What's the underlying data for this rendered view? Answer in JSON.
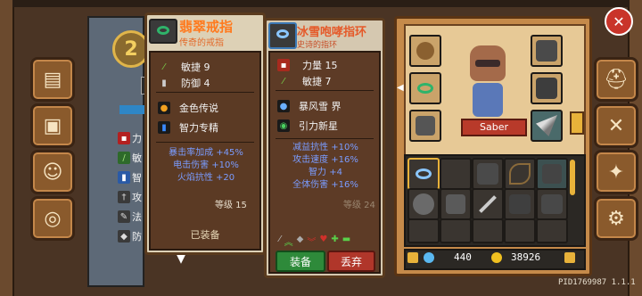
{
  "left_card": {
    "name": "翡翠戒指",
    "rarity": "传奇的戒指",
    "stats": [
      {
        "icon": "agility-icon",
        "label": "敏捷 9"
      },
      {
        "icon": "defense-icon",
        "label": "防御 4"
      }
    ],
    "perks": [
      {
        "icon": "gold-legend-icon",
        "label": "金色传说"
      },
      {
        "icon": "intellect-icon",
        "label": "智力专精"
      }
    ],
    "bonuses": [
      "暴击率加成 +45%",
      "电击伤害 +10%",
      "火焰抗性 +20"
    ],
    "level": "等级 15",
    "status": "已装备"
  },
  "right_card": {
    "name": "冰雪咆哮指环",
    "rarity": "史诗的指环",
    "stats": [
      {
        "icon": "strength-icon",
        "label": "力量 15"
      },
      {
        "icon": "agility-icon",
        "label": "敏捷 7"
      }
    ],
    "perks": [
      {
        "icon": "blizzard-icon",
        "label": "暴风雪 界"
      },
      {
        "icon": "gravity-icon",
        "label": "引力新星"
      }
    ],
    "bonuses": [
      "减益抗性 +10%",
      "攻击速度 +16%",
      "智力 +4",
      "全体伤害 +16%"
    ],
    "level": "等级 24",
    "equip_label": "装备",
    "discard_label": "丢弃"
  },
  "left_panel": {
    "level_badge": "2",
    "rows": [
      {
        "icon": "shirt-icon",
        "label": "力"
      },
      {
        "icon": "feather-icon",
        "label": "敏"
      },
      {
        "icon": "book-icon",
        "label": "智"
      },
      {
        "icon": "sword-icon",
        "label": "攻"
      },
      {
        "icon": "wand-icon",
        "label": "法"
      },
      {
        "icon": "shield-icon",
        "label": "防"
      }
    ]
  },
  "character": {
    "name": "Saber"
  },
  "currency": {
    "gems": "440",
    "gold": "38926"
  },
  "player_id": "PID1769987 1.1.1",
  "colors": {
    "legendary": "#ff7a1e",
    "epic": "#e55a2a",
    "stat_blue": "#7a9cff"
  }
}
